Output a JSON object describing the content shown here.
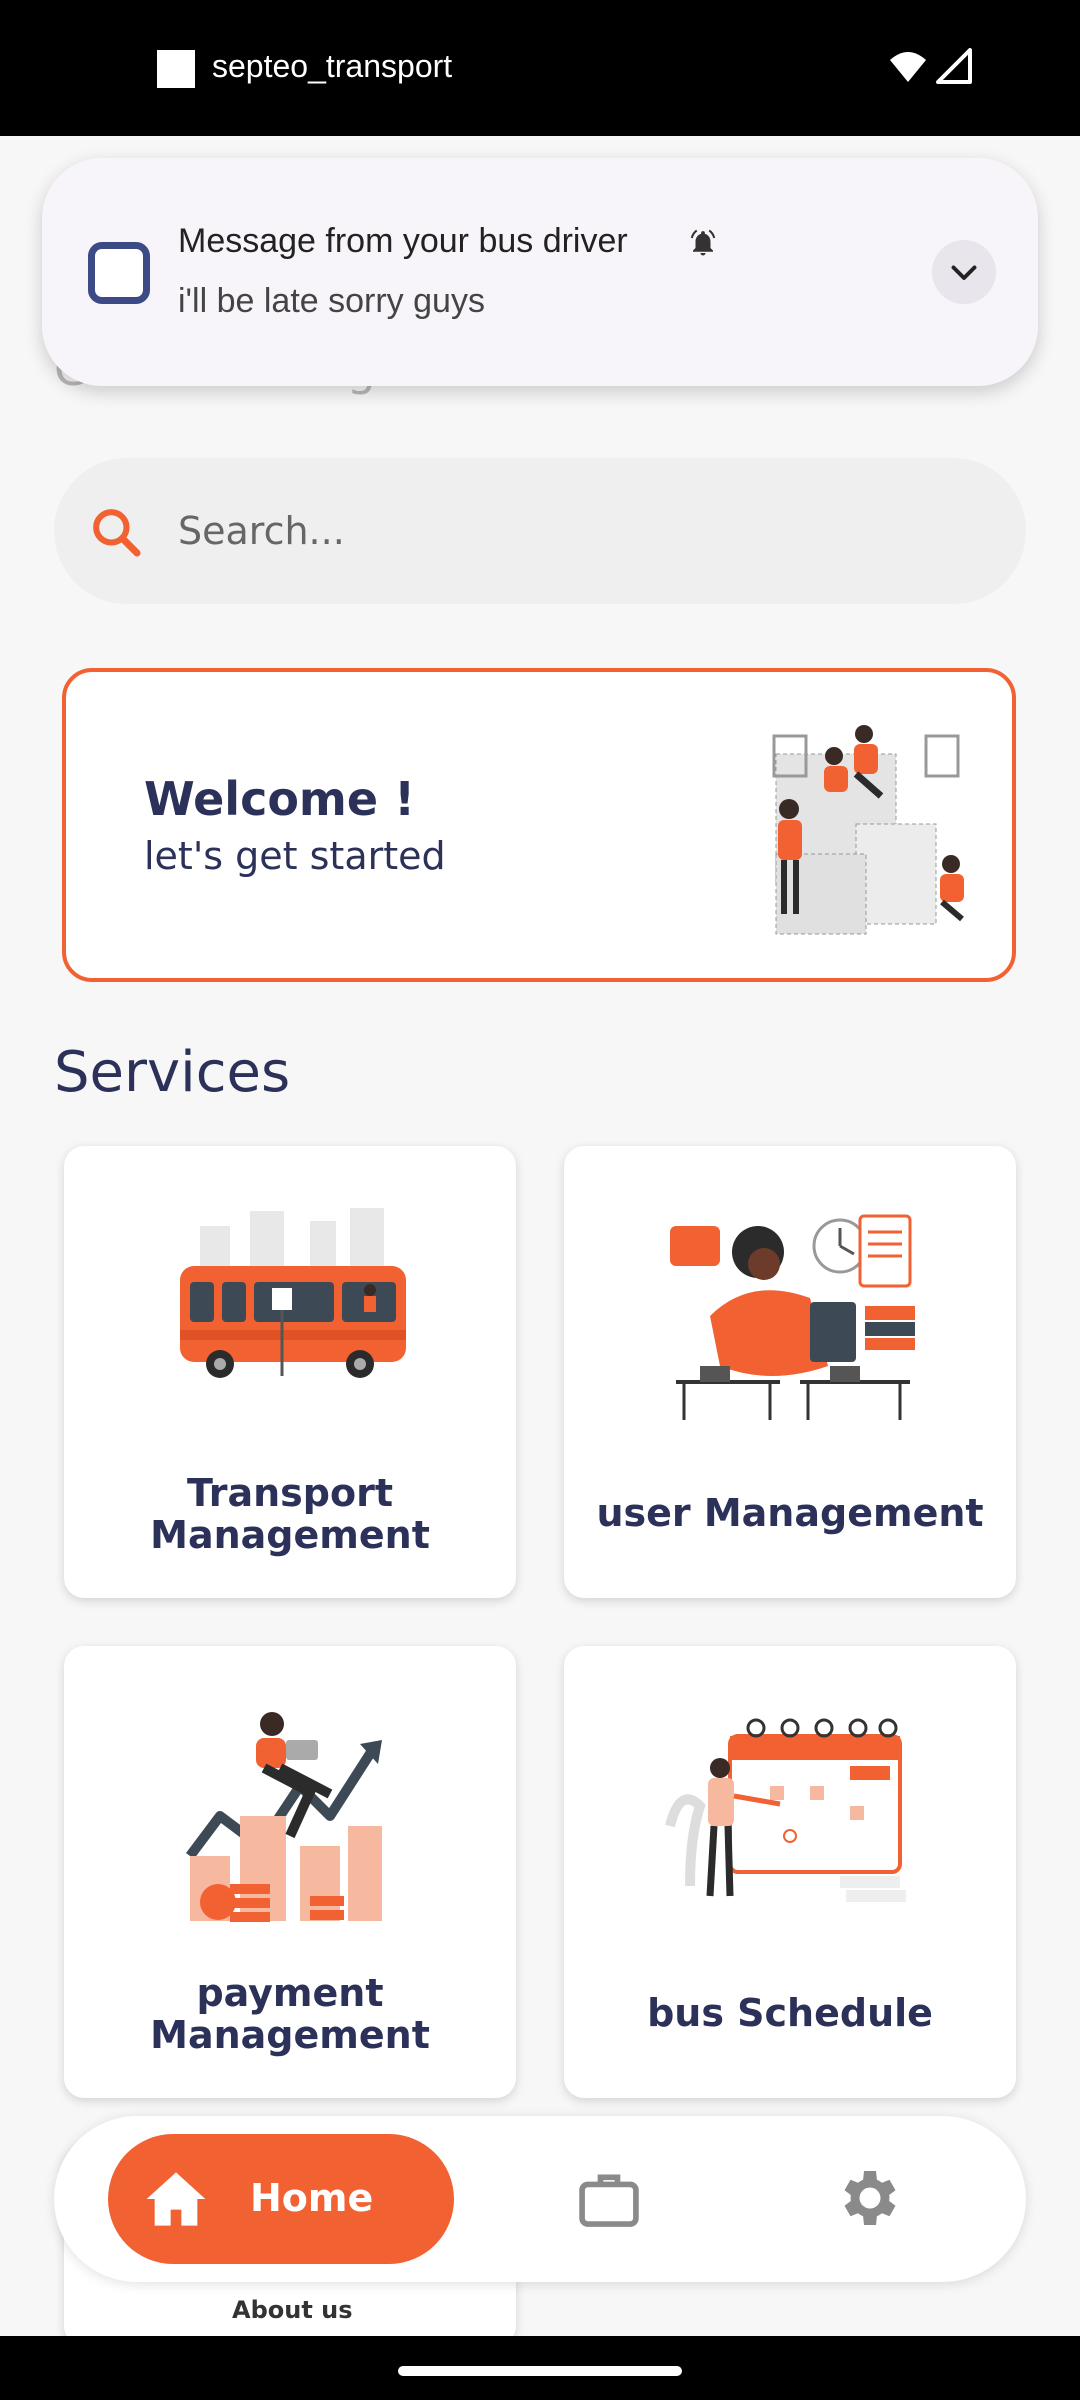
{
  "status_bar": {
    "app_name": "septeo_transport"
  },
  "greeting": "Good Morning",
  "notification": {
    "title": "Message from your bus driver",
    "body": "i'll be late sorry guys"
  },
  "search": {
    "placeholder": "Search..."
  },
  "welcome": {
    "title": "Welcome !",
    "subtitle": "let's get started"
  },
  "services": {
    "heading": "Services",
    "items": [
      {
        "label": "Transport\nManagement",
        "icon": "bus-illustration"
      },
      {
        "label": "user Management",
        "icon": "user-management-illustration"
      },
      {
        "label": "payment\nManagement",
        "icon": "payment-illustration"
      },
      {
        "label": "bus Schedule",
        "icon": "calendar-illustration"
      },
      {
        "label": "About us",
        "icon": "about-us-thumbnail"
      }
    ]
  },
  "bottom_nav": {
    "home_label": "Home",
    "items": [
      "home-icon",
      "briefcase-icon",
      "settings-icon"
    ]
  },
  "colors": {
    "accent": "#f26132",
    "navy": "#2b3158",
    "background": "#f7f7f7"
  }
}
